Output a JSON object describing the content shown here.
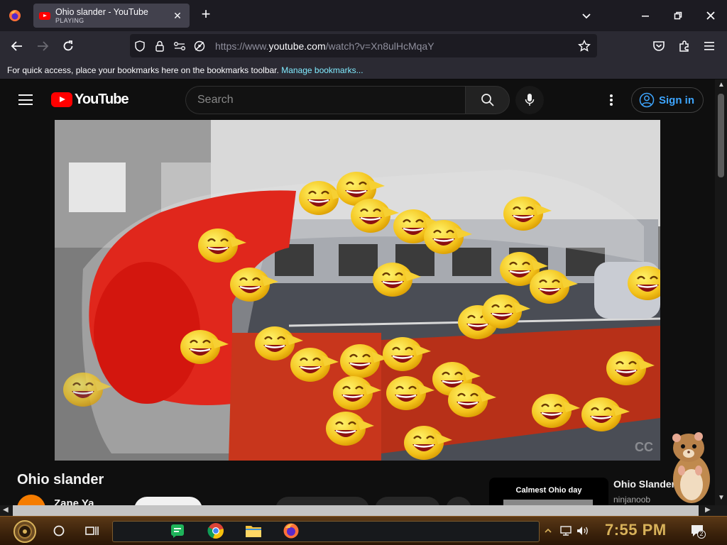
{
  "browser": {
    "tab": {
      "title": "Ohio slander - YouTube",
      "status": "PLAYING"
    },
    "url": {
      "prefix": "https://www.",
      "host": "youtube.com",
      "path": "/watch?v=Xn8ulHcMqaY"
    },
    "bookmarks_bar": {
      "message": "For quick access, place your bookmarks here on the bookmarks toolbar.",
      "link": "Manage bookmarks..."
    }
  },
  "youtube": {
    "logo_text": "YouTube",
    "search": {
      "placeholder": "Search"
    },
    "signin_label": "Sign in",
    "video": {
      "title": "Ohio slander",
      "channel": "Zane Ya",
      "watermark": "CC"
    },
    "related": {
      "thumb_label": "Calmest Ohio day",
      "title": "Ohio Slander",
      "channel": "ninjanoob"
    }
  },
  "taskbar": {
    "clock": "7:55 PM",
    "notification_count": "2"
  },
  "colors": {
    "youtube_red": "#ff0000",
    "link_blue": "#3ea6ff",
    "clock_gold": "#d8b25a"
  }
}
